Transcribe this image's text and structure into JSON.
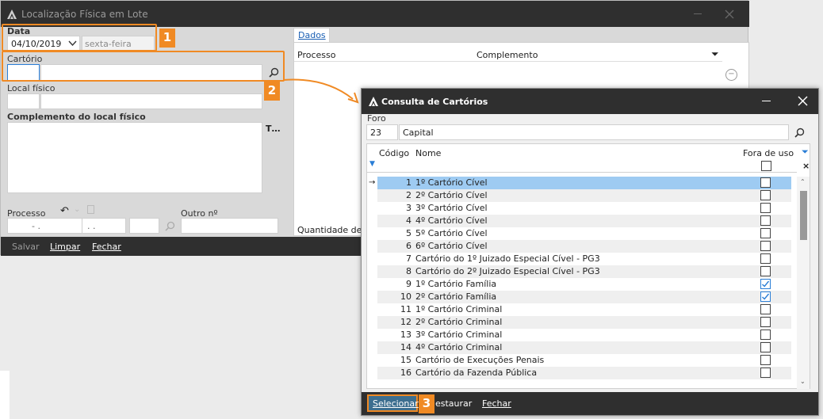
{
  "main_window": {
    "title": "Localização Física em Lote",
    "data_label": "Data",
    "date_value": "04/10/2019",
    "weekday_value": "sexta-feira",
    "cartorio_label": "Cartório",
    "local_fisico_label": "Local físico",
    "complemento_label": "Complemento do local físico",
    "processo_label": "Processo",
    "processo_part1": "- .",
    "processo_part2": ". .",
    "outro_label": "Outro nº",
    "dados_tab": "Dados",
    "col_processo": "Processo",
    "col_complemento": "Complemento",
    "quantidade_label": "Quantidade de p",
    "buttons": {
      "salvar": "Salvar",
      "limpar": "Limpar",
      "fechar": "Fechar"
    }
  },
  "callouts": {
    "one": "1",
    "two": "2",
    "three": "3"
  },
  "dialog": {
    "title": "Consulta de Cartórios",
    "foro_label": "Foro",
    "foro_code": "23",
    "foro_name": "Capital",
    "col_codigo": "Código",
    "col_nome": "Nome",
    "col_fora_de_uso": "Fora de uso",
    "rows": [
      {
        "code": "1",
        "name": "1º Cartório Cível",
        "fora": false
      },
      {
        "code": "2",
        "name": "2º Cartório Cível",
        "fora": false
      },
      {
        "code": "3",
        "name": "3º Cartório Cível",
        "fora": false
      },
      {
        "code": "4",
        "name": "4º Cartório Cível",
        "fora": false
      },
      {
        "code": "5",
        "name": "5º Cartório Cível",
        "fora": false
      },
      {
        "code": "6",
        "name": "6º Cartório Cível",
        "fora": false
      },
      {
        "code": "7",
        "name": "Cartório do 1º Juizado Especial Cível - PG3",
        "fora": false
      },
      {
        "code": "8",
        "name": "Cartório do 2º Juizado Especial Cível - PG3",
        "fora": false
      },
      {
        "code": "9",
        "name": "1º Cartório Família",
        "fora": true
      },
      {
        "code": "10",
        "name": "2º Cartório Família",
        "fora": true
      },
      {
        "code": "11",
        "name": "1º Cartório Criminal",
        "fora": false
      },
      {
        "code": "12",
        "name": "2º Cartório Criminal",
        "fora": false
      },
      {
        "code": "13",
        "name": "3º Cartório Criminal",
        "fora": false
      },
      {
        "code": "14",
        "name": "4º Cartório Criminal",
        "fora": false
      },
      {
        "code": "15",
        "name": "Cartório de Execuções Penais",
        "fora": false
      },
      {
        "code": "16",
        "name": "Cartório da Fazenda Pública",
        "fora": false
      }
    ],
    "buttons": {
      "selecionar": "Selecionar",
      "restaurar": "estaurar",
      "fechar": "Fechar"
    }
  }
}
